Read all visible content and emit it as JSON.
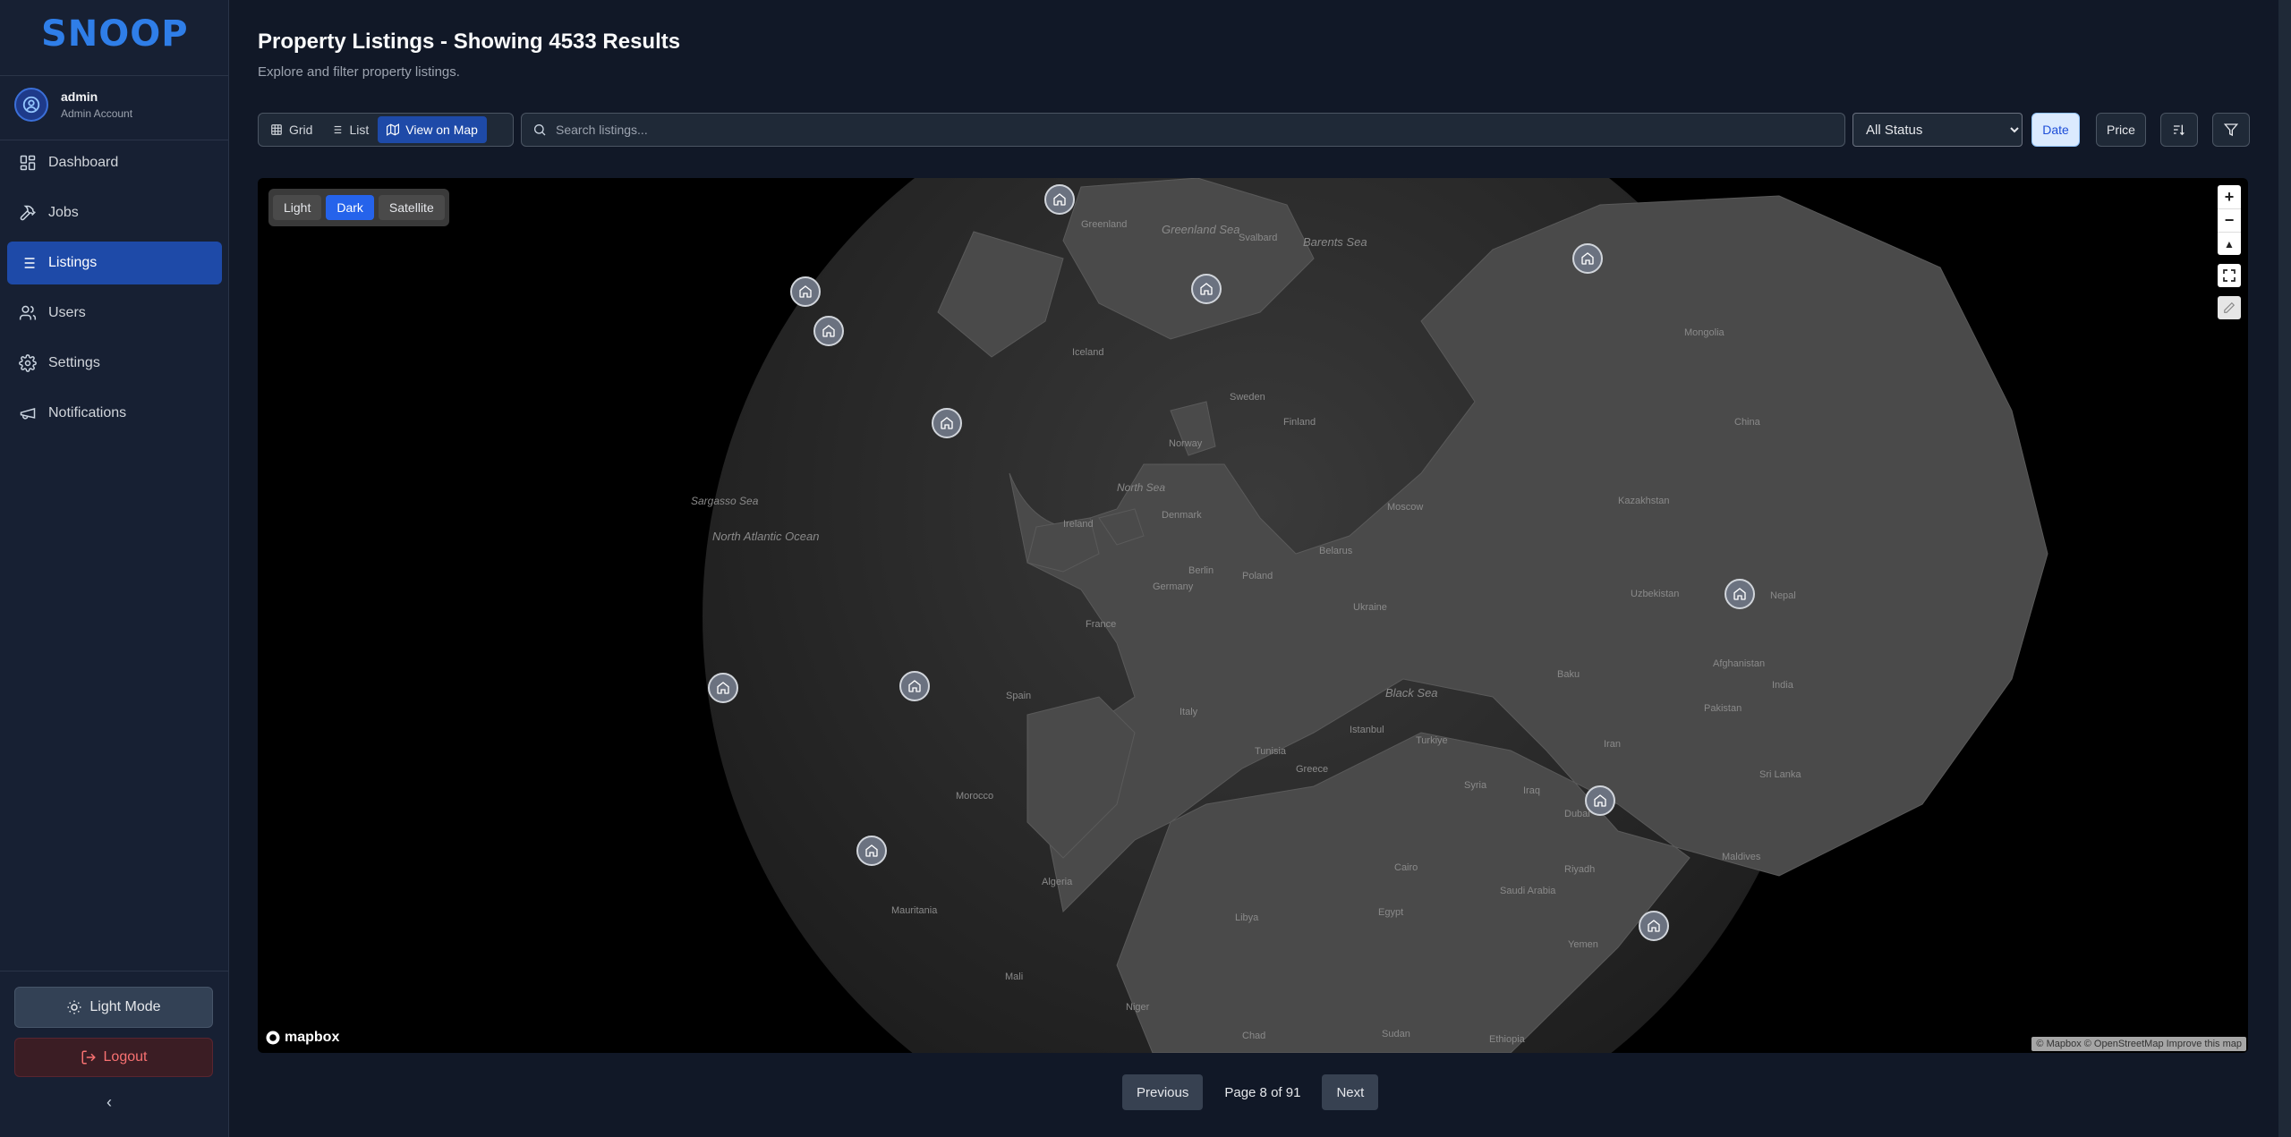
{
  "app": {
    "logo_text": "SNOOP"
  },
  "user": {
    "name": "admin",
    "role": "Admin Account"
  },
  "nav": [
    {
      "label": "Dashboard",
      "icon": "dashboard-icon",
      "active": false
    },
    {
      "label": "Jobs",
      "icon": "hammer-icon",
      "active": false
    },
    {
      "label": "Listings",
      "icon": "list-icon",
      "active": true
    },
    {
      "label": "Users",
      "icon": "users-icon",
      "active": false
    },
    {
      "label": "Settings",
      "icon": "gear-icon",
      "active": false
    },
    {
      "label": "Notifications",
      "icon": "megaphone-icon",
      "active": false
    }
  ],
  "sidebar_footer": {
    "theme_label": "Light Mode",
    "logout_label": "Logout",
    "collapse_glyph": "‹"
  },
  "header": {
    "title": "Property Listings - Showing 4533 Results",
    "subtitle": "Explore and filter property listings."
  },
  "toolbar": {
    "views": [
      {
        "label": "Grid",
        "active": false
      },
      {
        "label": "List",
        "active": false
      },
      {
        "label": "View on Map",
        "active": true
      }
    ],
    "search_placeholder": "Search listings...",
    "status_selected": "All Status",
    "sort_date": "Date",
    "sort_price": "Price"
  },
  "map": {
    "styles": [
      {
        "label": "Light",
        "active": false
      },
      {
        "label": "Dark",
        "active": true
      },
      {
        "label": "Satellite",
        "active": false
      }
    ],
    "logo_text": "mapbox",
    "attribution": "© Mapbox © OpenStreetMap Improve this map",
    "labels": [
      "Greenland",
      "Greenland Sea",
      "Svalbard",
      "Barents Sea",
      "Iceland",
      "Sweden",
      "Finland",
      "Norway",
      "North Sea",
      "Denmark",
      "Ireland",
      "North Atlantic Ocean",
      "Sargasso Sea",
      "Berlin",
      "Poland",
      "Germany",
      "France",
      "Ukraine",
      "Belarus",
      "Moscow",
      "Kazakhstan",
      "Spain",
      "Italy",
      "Black Sea",
      "Greece",
      "Turkiye",
      "Iraq",
      "Iran",
      "Afghanistan",
      "Pakistan",
      "India",
      "Algeria",
      "Libya",
      "Egypt",
      "Saudi Arabia",
      "Mali",
      "Niger",
      "Chad",
      "Sudan",
      "Morocco",
      "Mauritania",
      "Dubai",
      "China",
      "Mongolia",
      "Uzbekistan",
      "Nepal",
      "Sri Lanka",
      "Maldives",
      "Istanbul",
      "Cairo",
      "Riyadh",
      "Baku",
      "Tunisia",
      "Syria",
      "Yemen",
      "Ethiopia"
    ],
    "pin_count": 13
  },
  "pagination": {
    "prev_label": "Previous",
    "info": "Page 8 of 91",
    "next_label": "Next"
  }
}
